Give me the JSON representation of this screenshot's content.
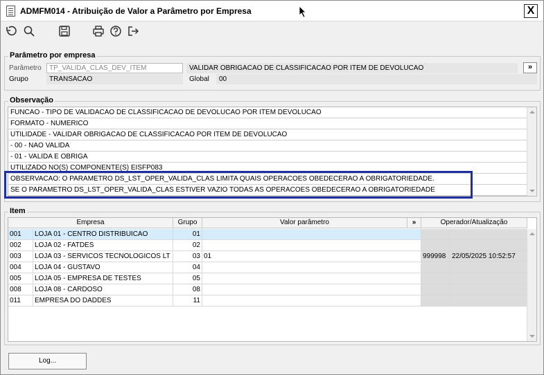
{
  "window": {
    "title": "ADMFM014 - Atribuição de Valor a Parâmetro por Empresa",
    "close_label": "X"
  },
  "toolbar": {
    "icons": [
      "undo-icon",
      "search-icon",
      "save-icon",
      "print-icon",
      "help-icon",
      "exit-icon"
    ]
  },
  "parametro_section": {
    "legend": "Parâmetro por empresa",
    "parametro_label": "Parâmetro",
    "parametro_value": "TP_VALIDA_CLAS_DEV_ITEM",
    "descricao_value": "VALIDAR OBRIGACAO DE CLASSIFICACAO POR ITEM DE DEVOLUCAO",
    "more_label": "»",
    "grupo_label": "Grupo",
    "grupo_value": "TRANSACAO",
    "global_label": "Global",
    "global_value": "00"
  },
  "observacao": {
    "legend": "Observação",
    "lines": [
      "FUNCAO - TIPO DE VALIDACAO DE CLASSIFICACAO DE DEVOLUCAO POR ITEM DEVOLUCAO",
      "FORMATO - NUMERICO",
      "UTILIDADE - VALIDAR OBRIGACAO DE CLASSIFICACAO POR ITEM DE DEVOLUCAO",
      " - 00 - NAO VALIDA",
      " - 01 - VALIDA E OBRIGA",
      "UTILIZADO NO(S) COMPONENTE(S) EISFP083",
      "OBSERVACAO: O PARAMETRO DS_LST_OPER_VALIDA_CLAS LIMITA QUAIS OPERACOES OBEDECERAO A OBRIGATORIEDADE.",
      "SE O PARAMETRO DS_LST_OPER_VALIDA_CLAS ESTIVER VAZIO TODAS AS OPERACOES OBEDECERAO A OBRIGATORIEDADE"
    ]
  },
  "item": {
    "legend": "Item",
    "headers": {
      "empresa": "Empresa",
      "grupo": "Grupo",
      "valor": "Valor parâmetro",
      "more": "»",
      "operador": "Operador/Atualização"
    },
    "rows": [
      {
        "code": "001",
        "name": "LOJA 01 - CENTRO DISTRIBUICAO",
        "grupo": "01",
        "valor": "",
        "operador": "",
        "data": ""
      },
      {
        "code": "002",
        "name": "LOJA 02 - FATDES",
        "grupo": "02",
        "valor": "",
        "operador": "",
        "data": ""
      },
      {
        "code": "003",
        "name": "LOJA 03 - SERVICOS TECNOLOGICOS LT",
        "grupo": "03",
        "valor": "01",
        "operador": "999998",
        "data": "22/05/2025 10:52:57"
      },
      {
        "code": "004",
        "name": "LOJA 04 - GUSTAVO",
        "grupo": "04",
        "valor": "",
        "operador": "",
        "data": ""
      },
      {
        "code": "005",
        "name": "LOJA 05 - EMPRESA DE TESTES",
        "grupo": "05",
        "valor": "",
        "operador": "",
        "data": ""
      },
      {
        "code": "008",
        "name": "LOJA 08 - CARDOSO",
        "grupo": "08",
        "valor": "",
        "operador": "",
        "data": ""
      },
      {
        "code": "011",
        "name": "EMPRESA DO DADDES",
        "grupo": "11",
        "valor": "",
        "operador": "",
        "data": ""
      }
    ]
  },
  "footer": {
    "log_label": "Log..."
  }
}
